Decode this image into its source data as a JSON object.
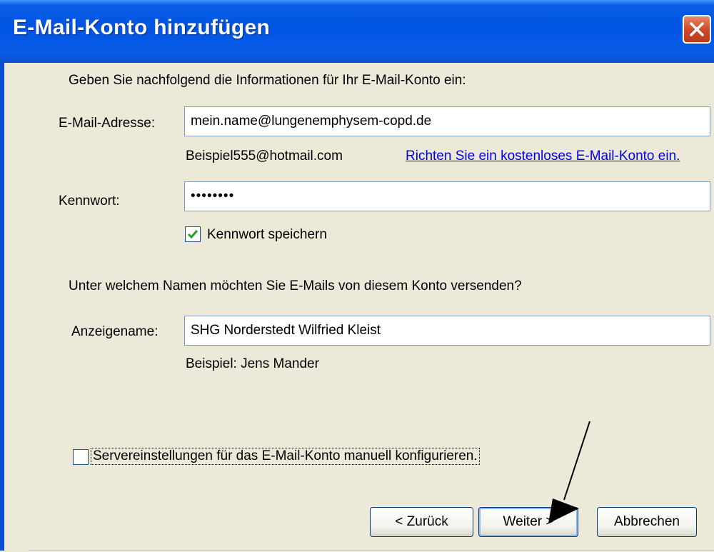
{
  "window": {
    "title": "E-Mail-Konto hinzufügen"
  },
  "intro": "Geben Sie nachfolgend die Informationen für Ihr E-Mail-Konto ein:",
  "email": {
    "label": "E-Mail-Adresse:",
    "value": "mein.name@lungenemphysem-copd.de",
    "example": "Beispiel555@hotmail.com",
    "link": "Richten Sie ein kostenloses E-Mail-Konto ein."
  },
  "password": {
    "label": "Kennwort:",
    "value": "••••••••",
    "save_label": "Kennwort speichern",
    "save_checked": true
  },
  "sender_question": "Unter welchem Namen möchten Sie E-Mails von diesem Konto versenden?",
  "display_name": {
    "label": "Anzeigename:",
    "value": "SHG Norderstedt Wilfried Kleist",
    "example": "Beispiel: Jens Mander"
  },
  "manual_config": {
    "label": "Servereinstellungen für das E-Mail-Konto manuell konfigurieren.",
    "checked": false
  },
  "buttons": {
    "back": "< Zurück",
    "next": "Weiter >",
    "cancel": "Abbrechen"
  },
  "colors": {
    "titlebar": "#0054e3",
    "dialog_bg": "#ece9d8",
    "link": "#0000ee",
    "check": "#21a121"
  }
}
